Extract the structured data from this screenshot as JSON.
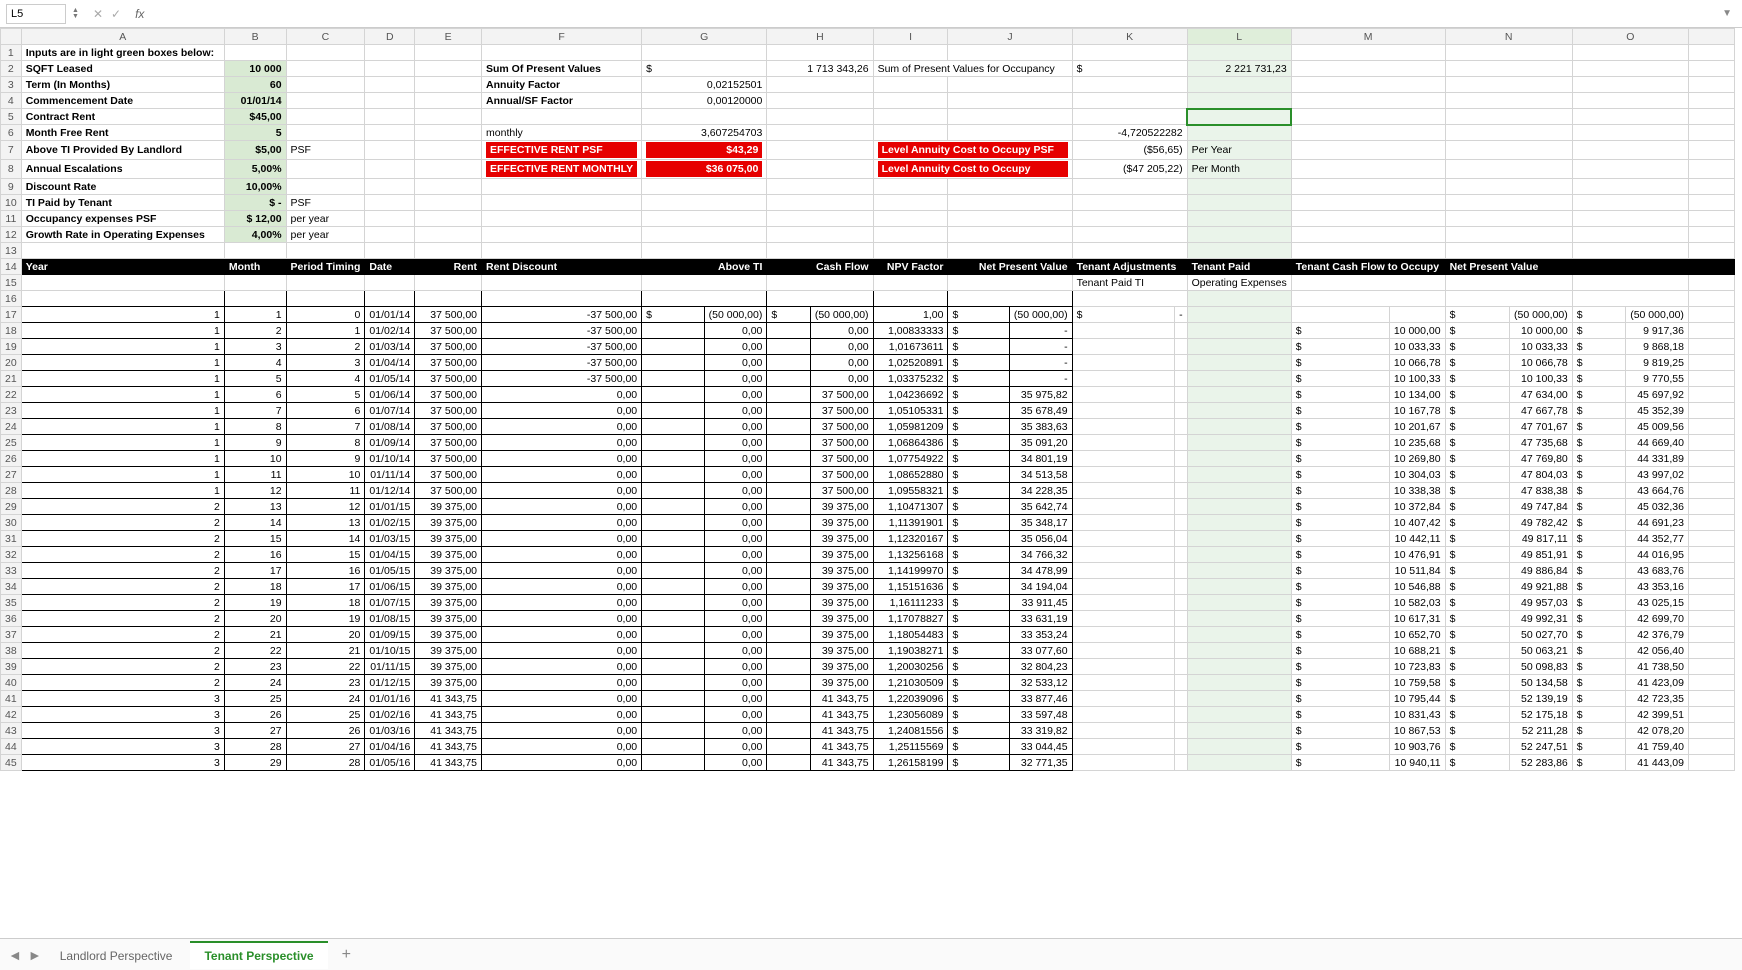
{
  "formula_bar": {
    "cell_ref": "L5",
    "fx_label": "fx",
    "value": ""
  },
  "columns": [
    "A",
    "B",
    "C",
    "D",
    "E",
    "F",
    "G",
    "H",
    "I",
    "J",
    "K",
    "L",
    "M",
    "N",
    "O"
  ],
  "inputs_header": "Inputs are in light green boxes below:",
  "inputs": [
    {
      "label": "SQFT Leased",
      "val": "10 000"
    },
    {
      "label": "Term (In Months)",
      "val": "60"
    },
    {
      "label": "Commencement Date",
      "val": "01/01/14"
    },
    {
      "label": "Contract Rent",
      "val": "$45,00"
    },
    {
      "label": "Month Free Rent",
      "val": "5"
    },
    {
      "label": "Above TI Provided By Landlord",
      "val": "$5,00",
      "unit": "PSF"
    },
    {
      "label": "Annual Escalations",
      "val": "5,00%"
    },
    {
      "label": "Discount Rate",
      "val": "10,00%"
    },
    {
      "label": "TI Paid by Tenant",
      "val": "$         -",
      "unit": "PSF"
    },
    {
      "label": "Occupancy expenses PSF",
      "val": "$      12,00",
      "unit": "per year"
    },
    {
      "label": "Growth Rate in Operating Expenses",
      "val": "4,00%",
      "unit": "per year"
    }
  ],
  "summary": {
    "spv_label": "Sum Of Present Values",
    "spv_cur": "$",
    "spv_val": "1 713 343,26",
    "af_label": "Annuity Factor",
    "af_val": "0,02152501",
    "asf_label": "Annual/SF Factor",
    "asf_val": "0,00120000",
    "monthly_label": "monthly",
    "monthly_val": "3,607254703",
    "erp_label": "EFFECTIVE RENT PSF",
    "erp_val": "$43,29",
    "erm_label": "EFFECTIVE RENT MONTHLY",
    "erm_val": "$36 075,00",
    "occ_label": "Sum of Present Values for Occupancy",
    "occ_cur": "$",
    "occ_val": "2 221 731,23",
    "k6": "-4,720522282",
    "lac_psf_label": "Level Annuity Cost to Occupy PSF",
    "lac_psf_val": "($56,65)",
    "lac_psf_unit": "Per Year",
    "lac_label": "Level Annuity Cost to Occupy",
    "lac_val": "($47 205,22)",
    "lac_unit": "Per Month"
  },
  "headers": {
    "year": "Year",
    "month": "Month",
    "pt": "Period Timing",
    "date": "Date",
    "rent": "Rent",
    "rd": "Rent Discount",
    "ati": "Above TI",
    "cf": "Cash Flow",
    "npvf": "NPV Factor",
    "npv": "Net Present Value",
    "ta": "Tenant Adjustments",
    "tp": "Tenant Paid",
    "ta_sub": "Tenant Paid TI",
    "tp_sub": "Operating Expenses",
    "tcfo": "Tenant Cash Flow to Occupy",
    "npv2": "Net Present Value"
  },
  "rows": [
    {
      "yr": "1",
      "mo": "1",
      "pt": "0",
      "dt": "01/01/14",
      "rent": "37 500,00",
      "rd": "-37 500,00",
      "ati": "(50 000,00)",
      "cf": "(50 000,00)",
      "npvf": "1,00",
      "npv": "(50 000,00)",
      "ta": "-",
      "tp": "",
      "tcfo": "(50 000,00)",
      "npv2": "(50 000,00)",
      "aticur": "$",
      "cfcur": "$",
      "npvfcur": "$",
      "npvcur": "$",
      "tacur": "$",
      "tcfocur": "$",
      "npv2cur": "$"
    },
    {
      "yr": "1",
      "mo": "2",
      "pt": "1",
      "dt": "01/02/14",
      "rent": "37 500,00",
      "rd": "-37 500,00",
      "ati": "0,00",
      "cf": "0,00",
      "npvf": "1,00833333",
      "npv": "-",
      "tp": "10 000,00",
      "tcfo": "10 000,00",
      "npv2": "9 917,36",
      "npvcur": "$",
      "tpcur": "$",
      "tcfocur": "$",
      "npv2cur": "$"
    },
    {
      "yr": "1",
      "mo": "3",
      "pt": "2",
      "dt": "01/03/14",
      "rent": "37 500,00",
      "rd": "-37 500,00",
      "ati": "0,00",
      "cf": "0,00",
      "npvf": "1,01673611",
      "npv": "-",
      "tp": "10 033,33",
      "tcfo": "10 033,33",
      "npv2": "9 868,18",
      "npvcur": "$",
      "tpcur": "$",
      "tcfocur": "$",
      "npv2cur": "$"
    },
    {
      "yr": "1",
      "mo": "4",
      "pt": "3",
      "dt": "01/04/14",
      "rent": "37 500,00",
      "rd": "-37 500,00",
      "ati": "0,00",
      "cf": "0,00",
      "npvf": "1,02520891",
      "npv": "-",
      "tp": "10 066,78",
      "tcfo": "10 066,78",
      "npv2": "9 819,25",
      "npvcur": "$",
      "tpcur": "$",
      "tcfocur": "$",
      "npv2cur": "$"
    },
    {
      "yr": "1",
      "mo": "5",
      "pt": "4",
      "dt": "01/05/14",
      "rent": "37 500,00",
      "rd": "-37 500,00",
      "ati": "0,00",
      "cf": "0,00",
      "npvf": "1,03375232",
      "npv": "-",
      "tp": "10 100,33",
      "tcfo": "10 100,33",
      "npv2": "9 770,55",
      "npvcur": "$",
      "tpcur": "$",
      "tcfocur": "$",
      "npv2cur": "$"
    },
    {
      "yr": "1",
      "mo": "6",
      "pt": "5",
      "dt": "01/06/14",
      "rent": "37 500,00",
      "rd": "0,00",
      "ati": "0,00",
      "cf": "37 500,00",
      "npvf": "1,04236692",
      "npv": "35 975,82",
      "tp": "10 134,00",
      "tcfo": "47 634,00",
      "npv2": "45 697,92",
      "npvcur": "$",
      "tpcur": "$",
      "tcfocur": "$",
      "npv2cur": "$"
    },
    {
      "yr": "1",
      "mo": "7",
      "pt": "6",
      "dt": "01/07/14",
      "rent": "37 500,00",
      "rd": "0,00",
      "ati": "0,00",
      "cf": "37 500,00",
      "npvf": "1,05105331",
      "npv": "35 678,49",
      "tp": "10 167,78",
      "tcfo": "47 667,78",
      "npv2": "45 352,39",
      "npvcur": "$",
      "tpcur": "$",
      "tcfocur": "$",
      "npv2cur": "$"
    },
    {
      "yr": "1",
      "mo": "8",
      "pt": "7",
      "dt": "01/08/14",
      "rent": "37 500,00",
      "rd": "0,00",
      "ati": "0,00",
      "cf": "37 500,00",
      "npvf": "1,05981209",
      "npv": "35 383,63",
      "tp": "10 201,67",
      "tcfo": "47 701,67",
      "npv2": "45 009,56",
      "npvcur": "$",
      "tpcur": "$",
      "tcfocur": "$",
      "npv2cur": "$"
    },
    {
      "yr": "1",
      "mo": "9",
      "pt": "8",
      "dt": "01/09/14",
      "rent": "37 500,00",
      "rd": "0,00",
      "ati": "0,00",
      "cf": "37 500,00",
      "npvf": "1,06864386",
      "npv": "35 091,20",
      "tp": "10 235,68",
      "tcfo": "47 735,68",
      "npv2": "44 669,40",
      "npvcur": "$",
      "tpcur": "$",
      "tcfocur": "$",
      "npv2cur": "$"
    },
    {
      "yr": "1",
      "mo": "10",
      "pt": "9",
      "dt": "01/10/14",
      "rent": "37 500,00",
      "rd": "0,00",
      "ati": "0,00",
      "cf": "37 500,00",
      "npvf": "1,07754922",
      "npv": "34 801,19",
      "tp": "10 269,80",
      "tcfo": "47 769,80",
      "npv2": "44 331,89",
      "npvcur": "$",
      "tpcur": "$",
      "tcfocur": "$",
      "npv2cur": "$"
    },
    {
      "yr": "1",
      "mo": "11",
      "pt": "10",
      "dt": "01/11/14",
      "rent": "37 500,00",
      "rd": "0,00",
      "ati": "0,00",
      "cf": "37 500,00",
      "npvf": "1,08652880",
      "npv": "34 513,58",
      "tp": "10 304,03",
      "tcfo": "47 804,03",
      "npv2": "43 997,02",
      "npvcur": "$",
      "tpcur": "$",
      "tcfocur": "$",
      "npv2cur": "$"
    },
    {
      "yr": "1",
      "mo": "12",
      "pt": "11",
      "dt": "01/12/14",
      "rent": "37 500,00",
      "rd": "0,00",
      "ati": "0,00",
      "cf": "37 500,00",
      "npvf": "1,09558321",
      "npv": "34 228,35",
      "tp": "10 338,38",
      "tcfo": "47 838,38",
      "npv2": "43 664,76",
      "npvcur": "$",
      "tpcur": "$",
      "tcfocur": "$",
      "npv2cur": "$"
    },
    {
      "yr": "2",
      "mo": "13",
      "pt": "12",
      "dt": "01/01/15",
      "rent": "39 375,00",
      "rd": "0,00",
      "ati": "0,00",
      "cf": "39 375,00",
      "npvf": "1,10471307",
      "npv": "35 642,74",
      "tp": "10 372,84",
      "tcfo": "49 747,84",
      "npv2": "45 032,36",
      "npvcur": "$",
      "tpcur": "$",
      "tcfocur": "$",
      "npv2cur": "$"
    },
    {
      "yr": "2",
      "mo": "14",
      "pt": "13",
      "dt": "01/02/15",
      "rent": "39 375,00",
      "rd": "0,00",
      "ati": "0,00",
      "cf": "39 375,00",
      "npvf": "1,11391901",
      "npv": "35 348,17",
      "tp": "10 407,42",
      "tcfo": "49 782,42",
      "npv2": "44 691,23",
      "npvcur": "$",
      "tpcur": "$",
      "tcfocur": "$",
      "npv2cur": "$"
    },
    {
      "yr": "2",
      "mo": "15",
      "pt": "14",
      "dt": "01/03/15",
      "rent": "39 375,00",
      "rd": "0,00",
      "ati": "0,00",
      "cf": "39 375,00",
      "npvf": "1,12320167",
      "npv": "35 056,04",
      "tp": "10 442,11",
      "tcfo": "49 817,11",
      "npv2": "44 352,77",
      "npvcur": "$",
      "tpcur": "$",
      "tcfocur": "$",
      "npv2cur": "$"
    },
    {
      "yr": "2",
      "mo": "16",
      "pt": "15",
      "dt": "01/04/15",
      "rent": "39 375,00",
      "rd": "0,00",
      "ati": "0,00",
      "cf": "39 375,00",
      "npvf": "1,13256168",
      "npv": "34 766,32",
      "tp": "10 476,91",
      "tcfo": "49 851,91",
      "npv2": "44 016,95",
      "npvcur": "$",
      "tpcur": "$",
      "tcfocur": "$",
      "npv2cur": "$"
    },
    {
      "yr": "2",
      "mo": "17",
      "pt": "16",
      "dt": "01/05/15",
      "rent": "39 375,00",
      "rd": "0,00",
      "ati": "0,00",
      "cf": "39 375,00",
      "npvf": "1,14199970",
      "npv": "34 478,99",
      "tp": "10 511,84",
      "tcfo": "49 886,84",
      "npv2": "43 683,76",
      "npvcur": "$",
      "tpcur": "$",
      "tcfocur": "$",
      "npv2cur": "$"
    },
    {
      "yr": "2",
      "mo": "18",
      "pt": "17",
      "dt": "01/06/15",
      "rent": "39 375,00",
      "rd": "0,00",
      "ati": "0,00",
      "cf": "39 375,00",
      "npvf": "1,15151636",
      "npv": "34 194,04",
      "tp": "10 546,88",
      "tcfo": "49 921,88",
      "npv2": "43 353,16",
      "npvcur": "$",
      "tpcur": "$",
      "tcfocur": "$",
      "npv2cur": "$"
    },
    {
      "yr": "2",
      "mo": "19",
      "pt": "18",
      "dt": "01/07/15",
      "rent": "39 375,00",
      "rd": "0,00",
      "ati": "0,00",
      "cf": "39 375,00",
      "npvf": "1,16111233",
      "npv": "33 911,45",
      "tp": "10 582,03",
      "tcfo": "49 957,03",
      "npv2": "43 025,15",
      "npvcur": "$",
      "tpcur": "$",
      "tcfocur": "$",
      "npv2cur": "$"
    },
    {
      "yr": "2",
      "mo": "20",
      "pt": "19",
      "dt": "01/08/15",
      "rent": "39 375,00",
      "rd": "0,00",
      "ati": "0,00",
      "cf": "39 375,00",
      "npvf": "1,17078827",
      "npv": "33 631,19",
      "tp": "10 617,31",
      "tcfo": "49 992,31",
      "npv2": "42 699,70",
      "npvcur": "$",
      "tpcur": "$",
      "tcfocur": "$",
      "npv2cur": "$"
    },
    {
      "yr": "2",
      "mo": "21",
      "pt": "20",
      "dt": "01/09/15",
      "rent": "39 375,00",
      "rd": "0,00",
      "ati": "0,00",
      "cf": "39 375,00",
      "npvf": "1,18054483",
      "npv": "33 353,24",
      "tp": "10 652,70",
      "tcfo": "50 027,70",
      "npv2": "42 376,79",
      "npvcur": "$",
      "tpcur": "$",
      "tcfocur": "$",
      "npv2cur": "$"
    },
    {
      "yr": "2",
      "mo": "22",
      "pt": "21",
      "dt": "01/10/15",
      "rent": "39 375,00",
      "rd": "0,00",
      "ati": "0,00",
      "cf": "39 375,00",
      "npvf": "1,19038271",
      "npv": "33 077,60",
      "tp": "10 688,21",
      "tcfo": "50 063,21",
      "npv2": "42 056,40",
      "npvcur": "$",
      "tpcur": "$",
      "tcfocur": "$",
      "npv2cur": "$"
    },
    {
      "yr": "2",
      "mo": "23",
      "pt": "22",
      "dt": "01/11/15",
      "rent": "39 375,00",
      "rd": "0,00",
      "ati": "0,00",
      "cf": "39 375,00",
      "npvf": "1,20030256",
      "npv": "32 804,23",
      "tp": "10 723,83",
      "tcfo": "50 098,83",
      "npv2": "41 738,50",
      "npvcur": "$",
      "tpcur": "$",
      "tcfocur": "$",
      "npv2cur": "$"
    },
    {
      "yr": "2",
      "mo": "24",
      "pt": "23",
      "dt": "01/12/15",
      "rent": "39 375,00",
      "rd": "0,00",
      "ati": "0,00",
      "cf": "39 375,00",
      "npvf": "1,21030509",
      "npv": "32 533,12",
      "tp": "10 759,58",
      "tcfo": "50 134,58",
      "npv2": "41 423,09",
      "npvcur": "$",
      "tpcur": "$",
      "tcfocur": "$",
      "npv2cur": "$"
    },
    {
      "yr": "3",
      "mo": "25",
      "pt": "24",
      "dt": "01/01/16",
      "rent": "41 343,75",
      "rd": "0,00",
      "ati": "0,00",
      "cf": "41 343,75",
      "npvf": "1,22039096",
      "npv": "33 877,46",
      "tp": "10 795,44",
      "tcfo": "52 139,19",
      "npv2": "42 723,35",
      "npvcur": "$",
      "tpcur": "$",
      "tcfocur": "$",
      "npv2cur": "$"
    },
    {
      "yr": "3",
      "mo": "26",
      "pt": "25",
      "dt": "01/02/16",
      "rent": "41 343,75",
      "rd": "0,00",
      "ati": "0,00",
      "cf": "41 343,75",
      "npvf": "1,23056089",
      "npv": "33 597,48",
      "tp": "10 831,43",
      "tcfo": "52 175,18",
      "npv2": "42 399,51",
      "npvcur": "$",
      "tpcur": "$",
      "tcfocur": "$",
      "npv2cur": "$"
    },
    {
      "yr": "3",
      "mo": "27",
      "pt": "26",
      "dt": "01/03/16",
      "rent": "41 343,75",
      "rd": "0,00",
      "ati": "0,00",
      "cf": "41 343,75",
      "npvf": "1,24081556",
      "npv": "33 319,82",
      "tp": "10 867,53",
      "tcfo": "52 211,28",
      "npv2": "42 078,20",
      "npvcur": "$",
      "tpcur": "$",
      "tcfocur": "$",
      "npv2cur": "$"
    },
    {
      "yr": "3",
      "mo": "28",
      "pt": "27",
      "dt": "01/04/16",
      "rent": "41 343,75",
      "rd": "0,00",
      "ati": "0,00",
      "cf": "41 343,75",
      "npvf": "1,25115569",
      "npv": "33 044,45",
      "tp": "10 903,76",
      "tcfo": "52 247,51",
      "npv2": "41 759,40",
      "npvcur": "$",
      "tpcur": "$",
      "tcfocur": "$",
      "npv2cur": "$"
    },
    {
      "yr": "3",
      "mo": "29",
      "pt": "28",
      "dt": "01/05/16",
      "rent": "41 343,75",
      "rd": "0,00",
      "ati": "0,00",
      "cf": "41 343,75",
      "npvf": "1,26158199",
      "npv": "32 771,35",
      "tp": "10 940,11",
      "tcfo": "52 283,86",
      "npv2": "41 443,09",
      "npvcur": "$",
      "tpcur": "$",
      "tcfocur": "$",
      "npv2cur": "$"
    }
  ],
  "tabs": {
    "t1": "Landlord Perspective",
    "t2": "Tenant Perspective"
  }
}
